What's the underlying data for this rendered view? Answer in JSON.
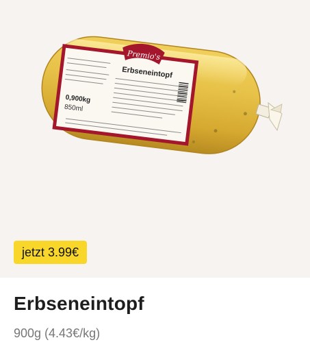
{
  "product": {
    "price_label": "jetzt 3.99€",
    "title": "Erbseneintopf",
    "subtitle": "900g (4.43€/kg)",
    "image": {
      "brand": "Premio's",
      "label_title": "Erbseneintopf",
      "weight": "0,900kg",
      "volume": "850ml"
    }
  },
  "colors": {
    "image_background": "#f6f3f1",
    "badge": "#f8d72a",
    "title": "#1e1e1e",
    "subtitle": "#777777",
    "sausage": "#e5be3f",
    "label_border": "#a3162c"
  }
}
